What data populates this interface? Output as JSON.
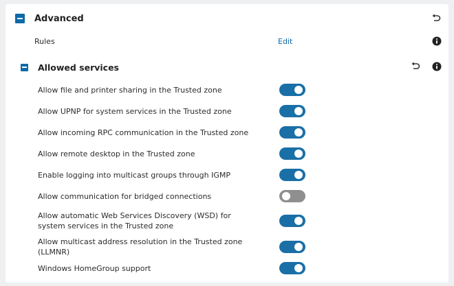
{
  "advanced": {
    "title": "Advanced",
    "rules_label": "Rules",
    "rules_edit": "Edit"
  },
  "allowed_services": {
    "title": "Allowed services",
    "items": [
      {
        "label": "Allow file and printer sharing in the Trusted zone",
        "enabled": true
      },
      {
        "label": "Allow UPNP for system services in the Trusted zone",
        "enabled": true
      },
      {
        "label": "Allow incoming RPC communication in the Trusted zone",
        "enabled": true
      },
      {
        "label": "Allow remote desktop in the Trusted zone",
        "enabled": true
      },
      {
        "label": "Enable logging into multicast groups through IGMP",
        "enabled": true
      },
      {
        "label": "Allow communication for bridged connections",
        "enabled": false
      },
      {
        "label": "Allow automatic Web Services Discovery (WSD) for system services in the Trusted zone",
        "enabled": true
      },
      {
        "label": "Allow multicast address resolution in the Trusted zone (LLMNR)",
        "enabled": true
      },
      {
        "label": "Windows HomeGroup support",
        "enabled": true
      }
    ]
  },
  "icons": {
    "collapse": "minus-square-icon",
    "revert": "undo-icon",
    "info": "info-circle-icon"
  },
  "colors": {
    "accent": "#0d6aa8",
    "toggle_on": "#1a6fa6",
    "toggle_off": "#8f8f8f"
  }
}
